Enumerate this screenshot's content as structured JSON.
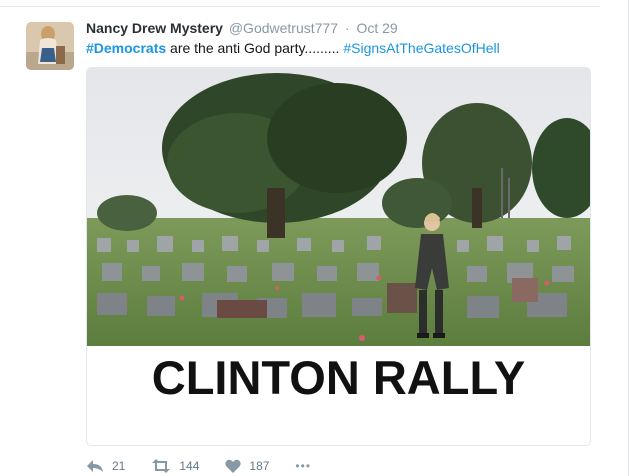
{
  "tweet": {
    "author_name": "Nancy Drew Mystery",
    "handle": "@Godwetrust777",
    "separator": "·",
    "timestamp": "Oct 29",
    "text_hashtag_1": "#Democrats",
    "text_body": " are the anti God party......... ",
    "text_hashtag_2": "#SignsAtTheGatesOfHell",
    "image_caption": "CLINTON RALLY"
  },
  "actions": {
    "reply_count": "21",
    "retweet_count": "144",
    "like_count": "187",
    "more_label": "•••"
  },
  "colors": {
    "accent": "#1b95e0",
    "muted": "#8899a6"
  },
  "icons": [
    "reply-icon",
    "retweet-icon",
    "like-icon",
    "more-icon"
  ]
}
